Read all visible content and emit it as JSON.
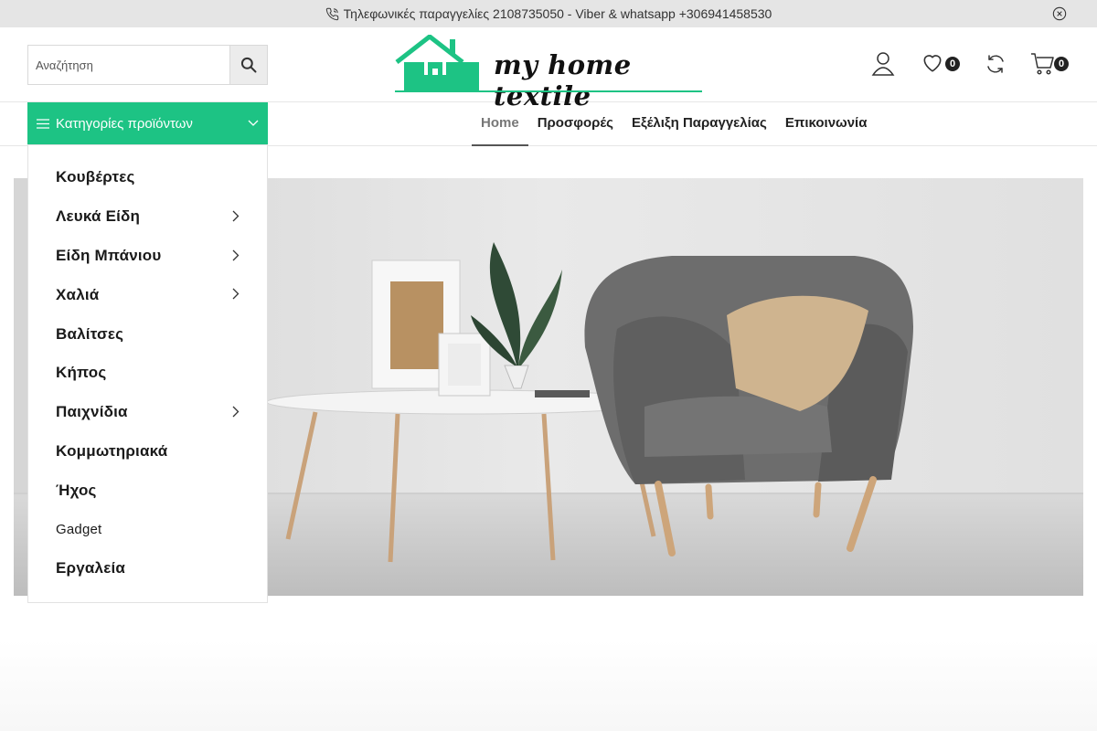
{
  "topbar": {
    "contact_text": "Τηλεφωνικές παραγγελίες 2108735050 - Viber & whatsapp +306941458530"
  },
  "search": {
    "placeholder": "Αναζήτηση"
  },
  "header": {
    "wishlist_count": "0",
    "cart_count": "0"
  },
  "logo": {
    "brand_text": "my home textile"
  },
  "categories_button": {
    "label": "Κατηγορίες προϊόντων"
  },
  "main_nav": [
    {
      "label": "Home"
    },
    {
      "label": "Προσφορές"
    },
    {
      "label": "Εξέλιξη Παραγγελίας"
    },
    {
      "label": "Επικοινωνία"
    }
  ],
  "category_menu": [
    {
      "label": "Κουβέρτες"
    },
    {
      "label": "Λευκά Είδη"
    },
    {
      "label": "Είδη Μπάνιου"
    },
    {
      "label": "Χαλιά"
    },
    {
      "label": "Βαλίτσες"
    },
    {
      "label": "Κήπος"
    },
    {
      "label": "Παιχνίδια"
    },
    {
      "label": "Κομμωτηριακά"
    },
    {
      "label": "Ήχος"
    },
    {
      "label": "Gadget"
    },
    {
      "label": "Εργαλεία"
    }
  ],
  "colors": {
    "accent": "#1dc384",
    "topbar_bg": "#e5e5e5"
  },
  "icons": [
    "phone-icon",
    "close-circle-icon",
    "search-icon",
    "user-icon",
    "heart-icon",
    "refresh-icon",
    "cart-icon",
    "menu-lines-icon",
    "chevron-down-icon",
    "chevron-right-icon"
  ]
}
